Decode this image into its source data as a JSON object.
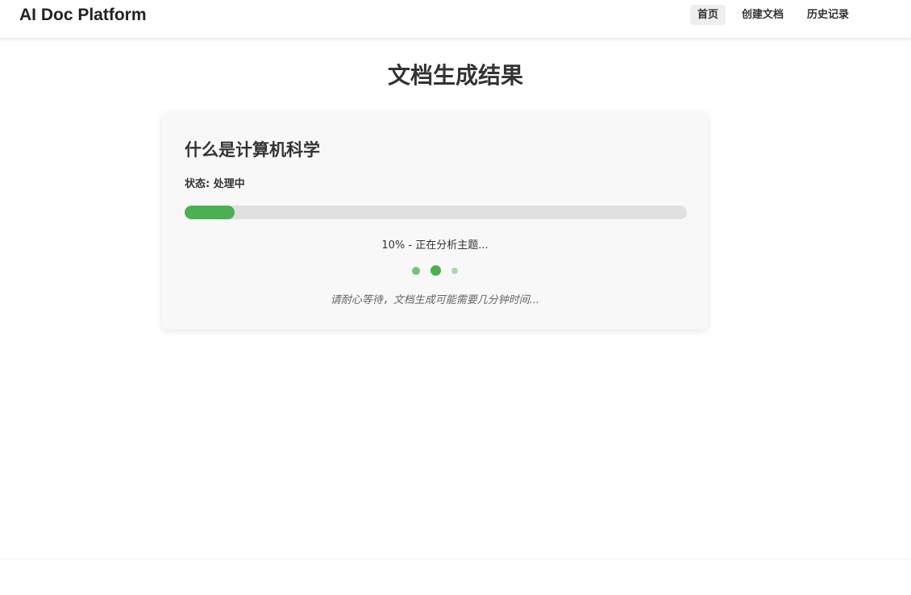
{
  "header": {
    "brand": "AI Doc Platform",
    "nav": [
      {
        "label": "首页",
        "active": true
      },
      {
        "label": "创建文档",
        "active": false
      },
      {
        "label": "历史记录",
        "active": false
      }
    ]
  },
  "main": {
    "page_title": "文档生成结果",
    "document": {
      "title": "什么是计算机科学",
      "status_label": "状态: 处理中",
      "progress": 0.1,
      "progress_text": "10% - 正在分析主题...",
      "wait_note": "请耐心等待，文档生成可能需要几分钟时间..."
    }
  },
  "colors": {
    "accent": "#4caf50",
    "track": "#e0e0e0",
    "card_bg": "#f8f8f8"
  }
}
